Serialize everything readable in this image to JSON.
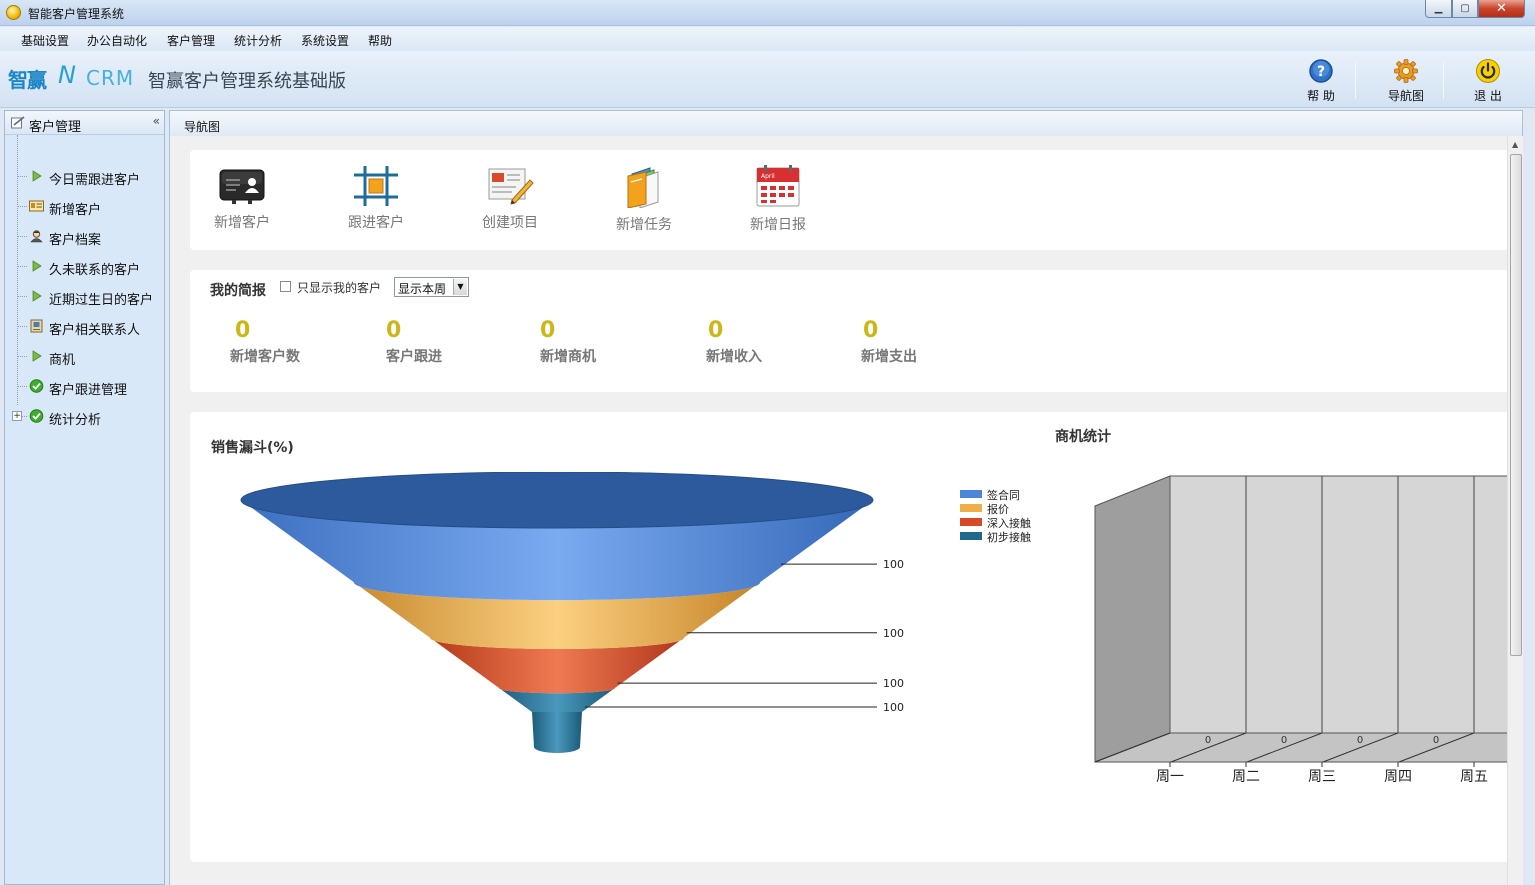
{
  "window": {
    "title": "智能客户管理系统"
  },
  "menu": [
    "基础设置",
    "办公自动化",
    "客户管理",
    "统计分析",
    "系统设置",
    "帮助"
  ],
  "header": {
    "logo": {
      "brand": "智赢",
      "n": "N",
      "crm": "CRM",
      "title": "智赢客户管理系统基础版"
    },
    "buttons": [
      {
        "label": "帮 助",
        "icon": "help-icon"
      },
      {
        "label": "导航图",
        "icon": "gear-icon"
      },
      {
        "label": "退 出",
        "icon": "power-icon"
      }
    ]
  },
  "sidebar": {
    "title": "客户管理",
    "collapse_glyph": "«",
    "items": [
      {
        "label": "今日需跟进客户",
        "icon": "play-arrow-icon"
      },
      {
        "label": "新增客户",
        "icon": "id-card-icon"
      },
      {
        "label": "客户档案",
        "icon": "person-icon"
      },
      {
        "label": "久未联系的客户",
        "icon": "play-arrow-icon"
      },
      {
        "label": "近期过生日的客户",
        "icon": "play-arrow-icon"
      },
      {
        "label": "客户相关联系人",
        "icon": "contact-book-icon"
      },
      {
        "label": "商机",
        "icon": "play-arrow-icon"
      },
      {
        "label": "客户跟进管理",
        "icon": "green-check-icon"
      },
      {
        "label": "统计分析",
        "icon": "green-check-icon",
        "expandable": true
      }
    ]
  },
  "tab": {
    "label": "导航图"
  },
  "quick_actions": [
    {
      "label": "新增客户",
      "icon": "business-card-icon"
    },
    {
      "label": "跟进客户",
      "icon": "frame-icon"
    },
    {
      "label": "创建项目",
      "icon": "document-pencil-icon"
    },
    {
      "label": "新增任务",
      "icon": "books-icon"
    },
    {
      "label": "新增日报",
      "icon": "calendar-icon"
    }
  ],
  "summary": {
    "title": "我的简报",
    "only_mine_label": "只显示我的客户",
    "only_mine_checked": false,
    "period": "显示本周",
    "stats": [
      {
        "label": "新增客户数",
        "value": "0"
      },
      {
        "label": "客户跟进",
        "value": "0"
      },
      {
        "label": "新增商机",
        "value": "0"
      },
      {
        "label": "新增收入",
        "value": "0"
      },
      {
        "label": "新增支出",
        "value": "0"
      }
    ]
  },
  "colors": {
    "accent_value": "#c9b817",
    "funnel": [
      "#4d86d9",
      "#f0ae48",
      "#d84a25",
      "#1e6a8c"
    ]
  },
  "calendar_icon_text": "April",
  "chart_data": [
    {
      "type": "funnel",
      "title": "销售漏斗(%)",
      "stages": [
        "签合同",
        "报价",
        "深入接触",
        "初步接触"
      ],
      "values": [
        100,
        100,
        100,
        100
      ],
      "legend": [
        "签合同",
        "报价",
        "深入接触",
        "初步接触"
      ],
      "legend_position": "right"
    },
    {
      "type": "bar",
      "title": "商机统计",
      "categories": [
        "周一",
        "周二",
        "周三",
        "周四",
        "周五"
      ],
      "values": [
        0,
        0,
        0,
        0,
        0
      ],
      "style": "3d"
    }
  ]
}
